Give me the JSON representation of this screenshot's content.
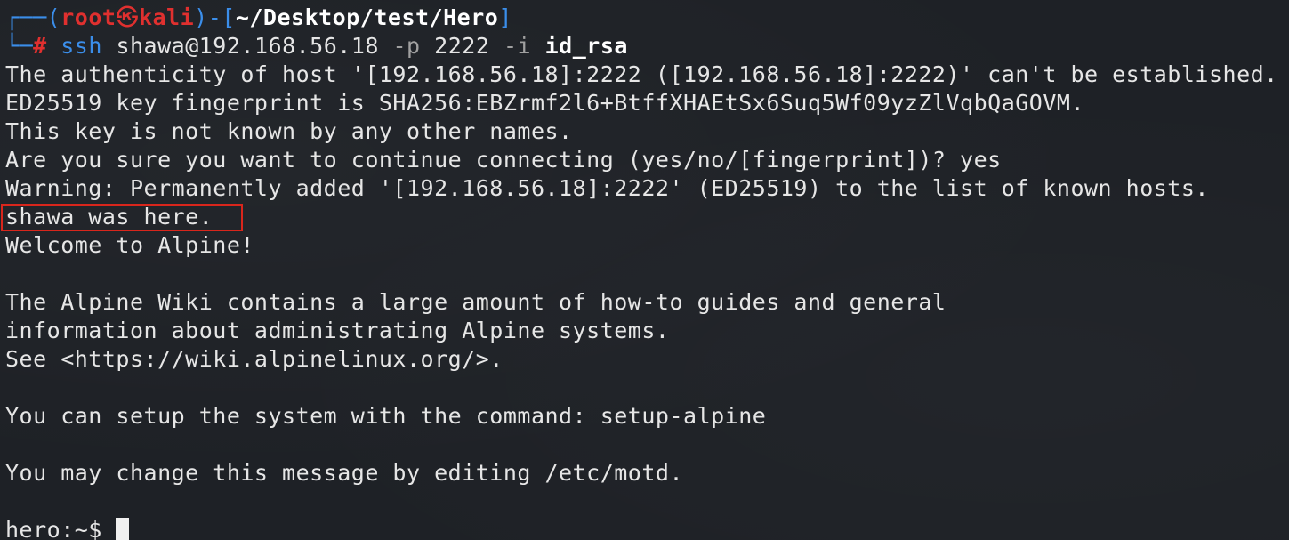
{
  "prompt": {
    "corner_top": "┌──(",
    "user": "root",
    "skull": "㉿",
    "host": "kali",
    "mid": ")-[",
    "path": "~/Desktop/test/Hero",
    "end": "]",
    "corner_bottom": "└─",
    "hash": "#"
  },
  "command": {
    "program": "ssh",
    "target": "shawa@192.168.56.18",
    "port_flag": "-p",
    "port": "2222",
    "identity_flag": "-i",
    "identity_file": "id_rsa"
  },
  "output": {
    "authenticity": "The authenticity of host '[192.168.56.18]:2222 ([192.168.56.18]:2222)' can't be established.",
    "fingerprint": "ED25519 key fingerprint is SHA256:EBZrmf2l6+BtffXHAEtSx6Suq5Wf09yzZlVqbQaGOVM.",
    "not_known": "This key is not known by any other names.",
    "continue_prompt": "Are you sure you want to continue connecting (yes/no/[fingerprint])? yes",
    "warning": "Warning: Permanently added '[192.168.56.18]:2222' (ED25519) to the list of known hosts.",
    "banner": "shawa was here.",
    "welcome": "Welcome to Alpine!",
    "wiki_1": "The Alpine Wiki contains a large amount of how-to guides and general",
    "wiki_2": "information about administrating Alpine systems.",
    "wiki_3": "See <https://wiki.alpinelinux.org/>.",
    "setup": "You can setup the system with the command: setup-alpine",
    "motd": "You may change this message by editing /etc/motd."
  },
  "shell_prompt": "hero:~$ ",
  "colors": {
    "background": "#1e2126",
    "text": "#e6e6e6",
    "prompt_blue": "#3b8eea",
    "prompt_red": "#e0302f",
    "highlight_box": "#d9261c"
  }
}
